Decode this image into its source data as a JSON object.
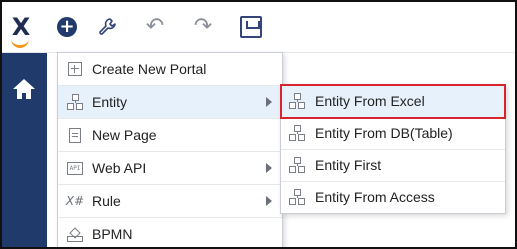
{
  "toolbar": {
    "icons": [
      "x-logo-icon",
      "add-circle-icon",
      "wrench-icon",
      "undo-icon",
      "redo-icon",
      "save-icon"
    ],
    "glyphs": {
      "logo": "X",
      "add": "+",
      "wrench": "🔧",
      "undo": "↶",
      "redo": "↷"
    }
  },
  "sidebar": {
    "items": [
      "home-icon"
    ]
  },
  "menu": {
    "items": [
      {
        "label": "Create New Portal",
        "icon": "add-box-icon",
        "has_submenu": false
      },
      {
        "label": "Entity",
        "icon": "entity-hierarchy-icon",
        "has_submenu": true,
        "active": true
      },
      {
        "label": "New Page",
        "icon": "page-icon",
        "has_submenu": false
      },
      {
        "label": "Web API",
        "icon": "api-icon",
        "has_submenu": true,
        "icon_text": "API"
      },
      {
        "label": "Rule",
        "icon": "rule-icon",
        "has_submenu": true,
        "icon_text": "X#"
      },
      {
        "label": "BPMN",
        "icon": "bpmn-icon",
        "has_submenu": false
      }
    ]
  },
  "submenu": {
    "items": [
      {
        "label": "Entity From Excel",
        "icon": "entity-hierarchy-icon",
        "highlighted": true
      },
      {
        "label": "Entity From DB(Table)",
        "icon": "entity-hierarchy-icon"
      },
      {
        "label": "Entity First",
        "icon": "entity-hierarchy-icon"
      },
      {
        "label": "Entity From Access",
        "icon": "entity-hierarchy-icon"
      }
    ]
  },
  "colors": {
    "navy": "#1f3a6b",
    "accent_orange": "#f39a1e",
    "highlight_red": "#d9232e",
    "active_bg": "#e6f1fb"
  }
}
